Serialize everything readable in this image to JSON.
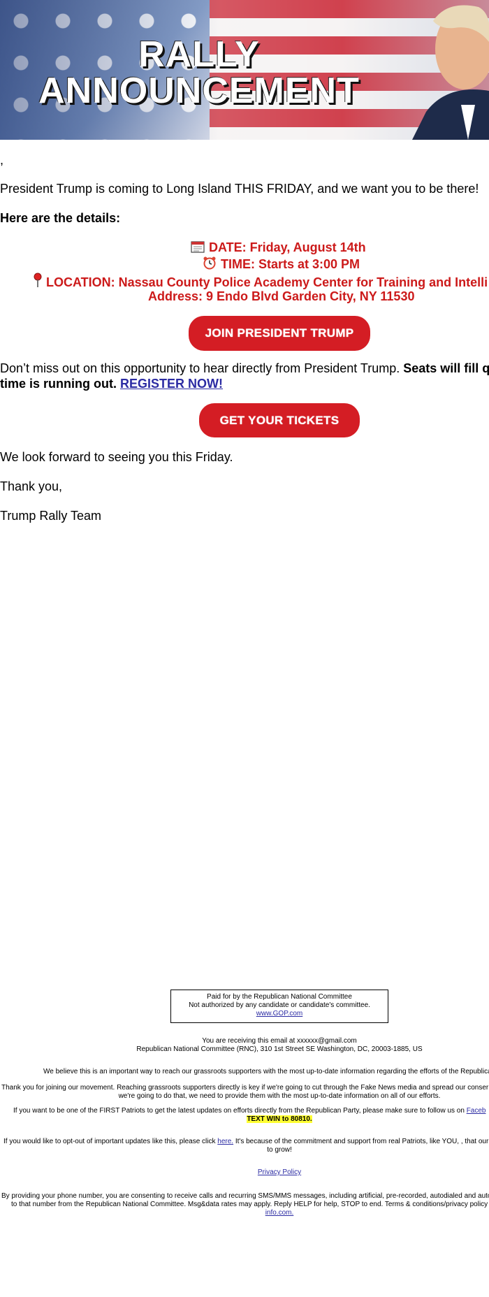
{
  "banner": {
    "title_line1": "RALLY",
    "title_line2": "ANNOUNCEMENT"
  },
  "greeting": ",",
  "intro": "President Trump is coming to Long Island THIS FRIDAY, and we want you to be there!",
  "details_heading": "Here are the details:",
  "details": {
    "date": "DATE: Friday, August 14th",
    "time": "TIME: Starts at 3:00 PM",
    "location": "LOCATION: Nassau County Police Academy Center for Training and Intelli",
    "address": "Address: 9 Endo Blvd Garden City, NY 11530"
  },
  "buttons": {
    "join": "JOIN PRESIDENT TRUMP",
    "tickets": "GET YOUR TICKETS"
  },
  "cta": {
    "line1_normal": "Don’t miss out on this opportunity to hear directly from President Trump. ",
    "line1_bold": "Seats will fill q",
    "line2_bold": "time is running out. ",
    "register_link": "REGISTER NOW!"
  },
  "closing": {
    "forward": "We look forward to seeing you this Friday.",
    "thanks": "Thank you,",
    "signature": "Trump Rally Team"
  },
  "footer": {
    "paid_line1": "Paid for by the Republican National Committee",
    "paid_line2": "Not authorized by any candidate or candidate's committee.",
    "paid_link": "www.GOP.com",
    "receiving": "You are receiving this email at xxxxxx@gmail.com",
    "address": "Republican National Committee (RNC), 310 1st Street SE Washington, DC, 20003-1885, US",
    "believe": "We believe this is an important way to reach our grassroots supporters with the most up-to-date information regarding the efforts of the Republica",
    "thankyou_line1": "Thank you for joining our movement. Reaching grassroots supporters directly is key if we're going to cut through the Fake News media and spread our conser",
    "thankyou_line2": "we're going to do that, we need to provide them with the most up-to-date information on all of our efforts.",
    "first_line1": "If you want to be one of the FIRST Patriots to get the latest updates on efforts directly from the Republican Party, please make sure to follow us on ",
    "first_link": "Faceb",
    "text_win": "TEXT WIN to 80810.",
    "optout_pre": "If you would like to opt-out of important updates like this, please click ",
    "optout_link": "here.",
    "optout_post": " It's because of the commitment and support from real Patriots, like YOU, , that our",
    "optout_line2": "to grow!",
    "privacy": "Privacy Policy",
    "sms_line1": "By providing your phone number, you are consenting to receive calls and recurring SMS/MMS messages, including artificial, pre-recorded, autodialed and auto",
    "sms_line2": "to that number from the Republican National Committee. Msg&data rates may apply. Reply HELP for help, STOP to end. Terms & conditions/privacy policy",
    "sms_link": "info.com."
  },
  "colors": {
    "accent_red": "#d41d24",
    "detail_red": "#cc1a1a",
    "link_blue": "#2b2ba3",
    "highlight": "#ffff33"
  },
  "icons": [
    "calendar-icon",
    "alarm-clock-icon",
    "pushpin-icon"
  ]
}
